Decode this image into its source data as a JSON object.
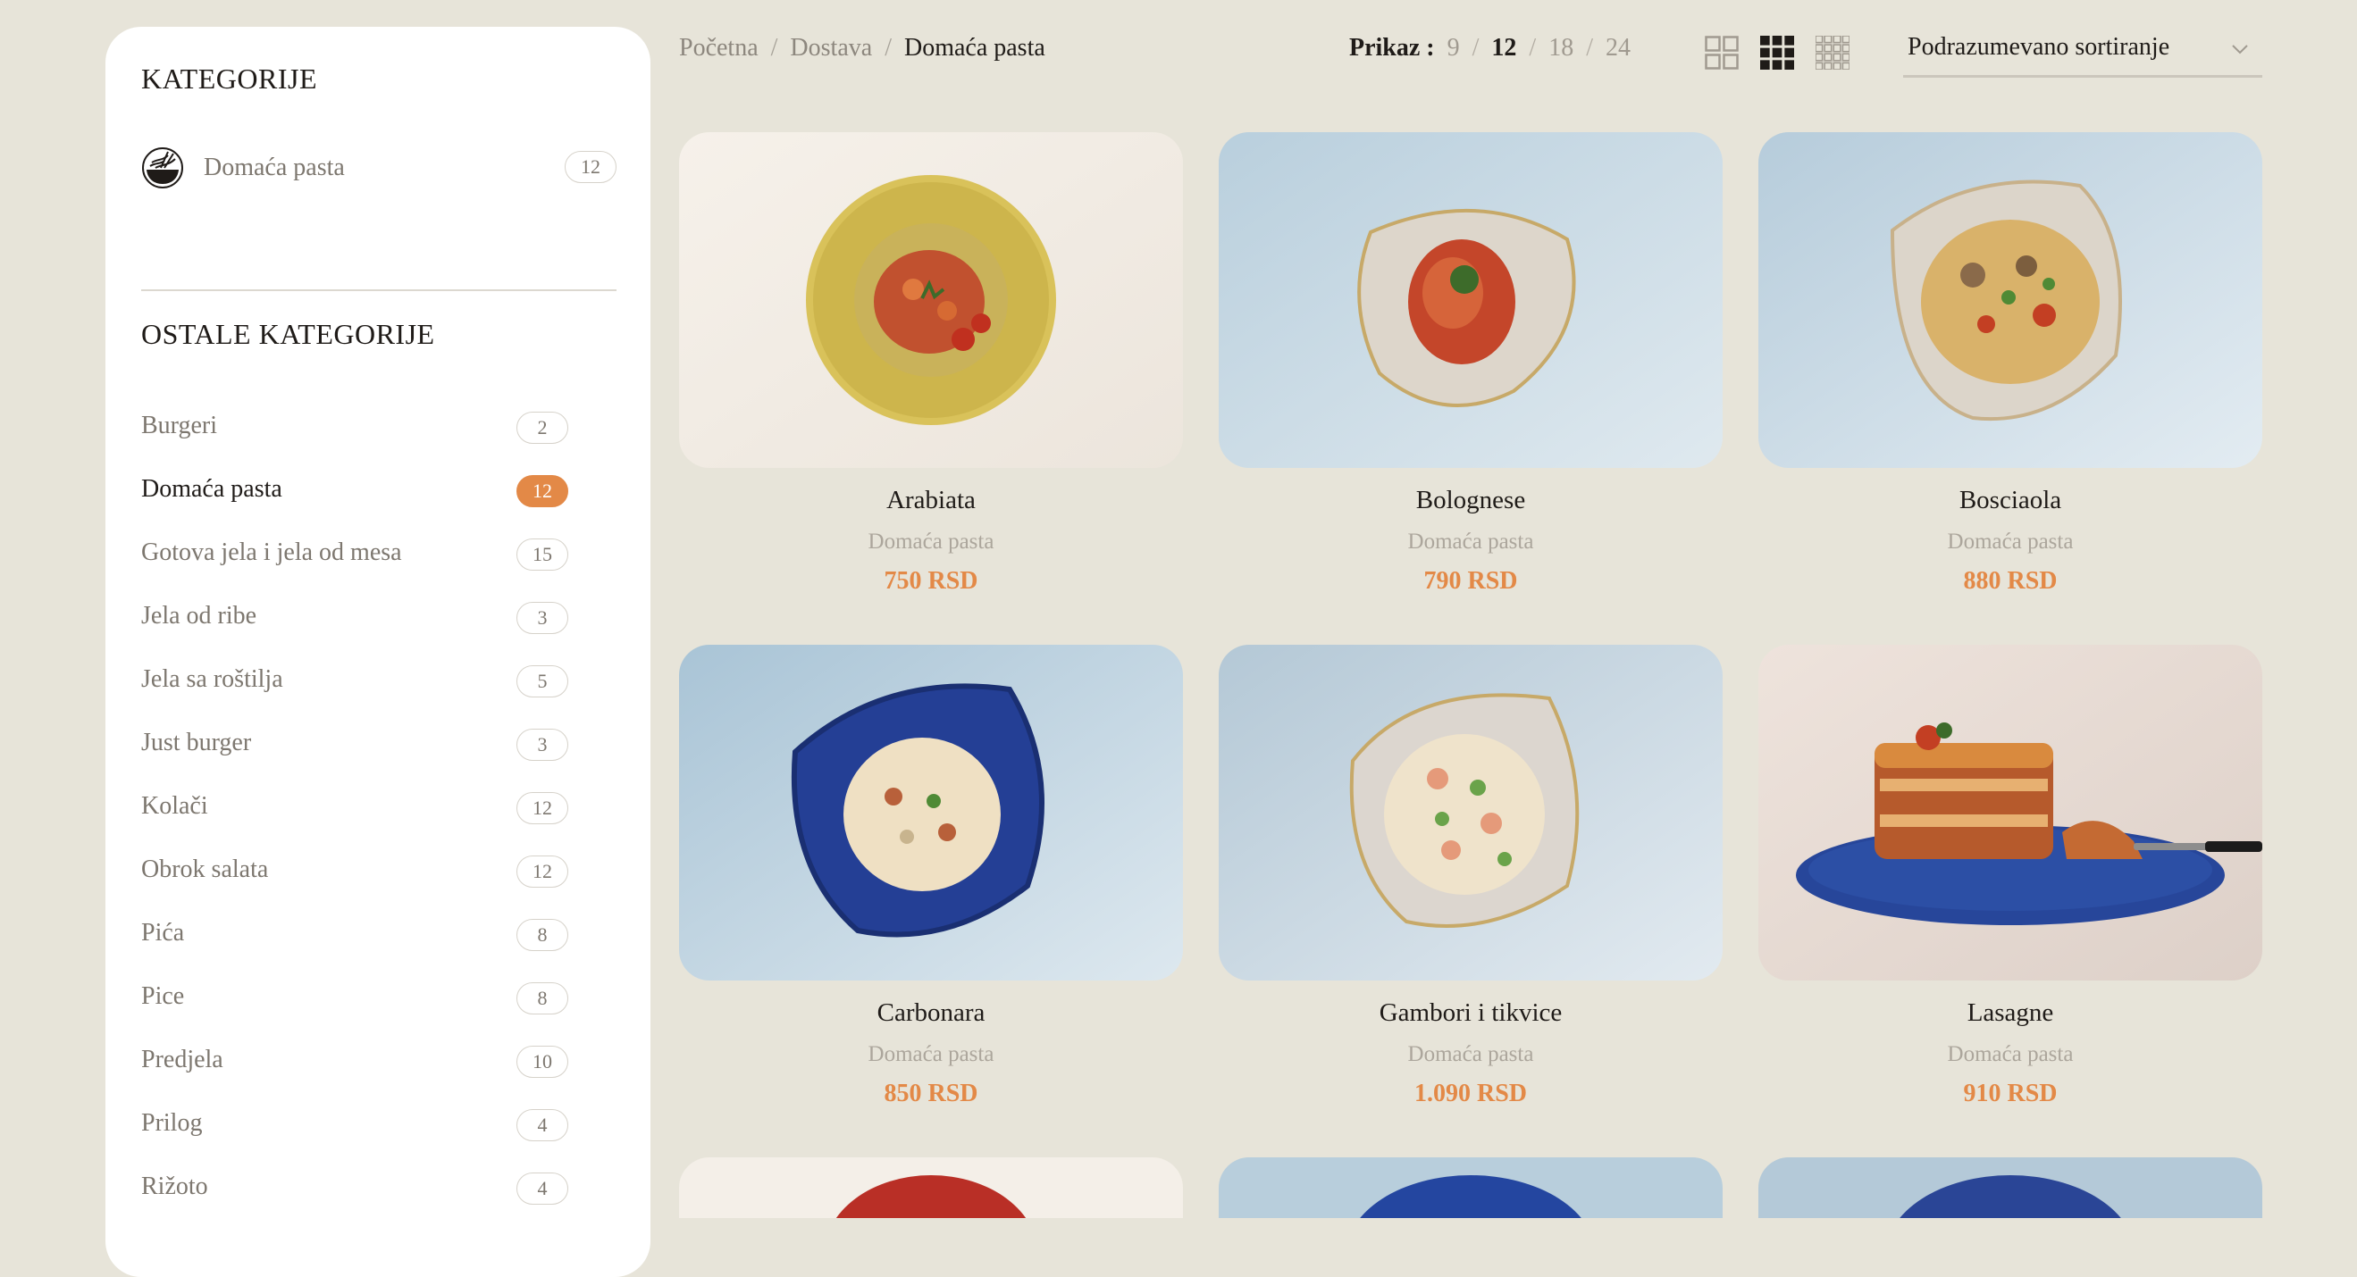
{
  "sidebar": {
    "title": "KATEGORIJE",
    "current_category": {
      "label": "Domaća pasta",
      "count": "12"
    },
    "other_title": "OSTALE KATEGORIJE",
    "categories": [
      {
        "label": "Burgeri",
        "count": "2"
      },
      {
        "label": "Domaća pasta",
        "count": "12",
        "active": true
      },
      {
        "label": "Gotova jela i jela od mesa",
        "count": "15"
      },
      {
        "label": "Jela od ribe",
        "count": "3"
      },
      {
        "label": "Jela sa roštilja",
        "count": "5"
      },
      {
        "label": "Just burger",
        "count": "3"
      },
      {
        "label": "Kolači",
        "count": "12"
      },
      {
        "label": "Obrok salata",
        "count": "12"
      },
      {
        "label": "Pića",
        "count": "8"
      },
      {
        "label": "Pice",
        "count": "8"
      },
      {
        "label": "Predjela",
        "count": "10"
      },
      {
        "label": "Prilog",
        "count": "4"
      },
      {
        "label": "Rižoto",
        "count": "4"
      }
    ]
  },
  "breadcrumb": {
    "home": "Početna",
    "parent": "Dostava",
    "current": "Domaća pasta"
  },
  "toolbar": {
    "show_label": "Prikaz :",
    "show_options": [
      "9",
      "12",
      "18",
      "24"
    ],
    "show_selected": "12",
    "view_modes": [
      "grid-2-icon",
      "grid-3-icon",
      "grid-4-icon"
    ],
    "view_selected": "grid-3-icon",
    "sort_value": "Podrazumevano sortiranje"
  },
  "products": [
    {
      "name": "Arabiata",
      "category": "Domaća pasta",
      "price": "750 RSD"
    },
    {
      "name": "Bolognese",
      "category": "Domaća pasta",
      "price": "790 RSD"
    },
    {
      "name": "Bosciaola",
      "category": "Domaća pasta",
      "price": "880 RSD"
    },
    {
      "name": "Carbonara",
      "category": "Domaća pasta",
      "price": "850 RSD"
    },
    {
      "name": "Gambori i tikvice",
      "category": "Domaća pasta",
      "price": "1.090 RSD"
    },
    {
      "name": "Lasagne",
      "category": "Domaća pasta",
      "price": "910 RSD"
    }
  ],
  "colors": {
    "background": "#e7e4d9",
    "accent": "#e38947",
    "text": "#1f1b18",
    "muted": "#7d776f"
  }
}
